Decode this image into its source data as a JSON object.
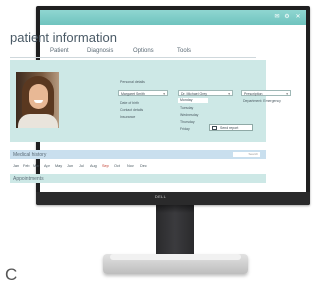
{
  "app": {
    "title": "patient information"
  },
  "tabs": [
    "Patient",
    "Diagnosis",
    "Options",
    "Tools"
  ],
  "window_icons": [
    "mail-icon",
    "gear-icon",
    "close-icon"
  ],
  "details": {
    "section_label": "Personal details",
    "name_field": "Margaret Smith",
    "field_labels": [
      "Date of birth",
      "Contact details",
      "Insurance"
    ],
    "doctor_field": "Dr. Michael Grey",
    "doctor_list": [
      "Monday",
      "Tuesday",
      "Wednesday",
      "Thursday",
      "Friday"
    ],
    "dept_field": "Prescription",
    "dept_label": "Department: Emergency",
    "request_button": "Send report"
  },
  "history": {
    "label": "Medical history",
    "search_placeholder": "Search"
  },
  "months": [
    "Jan",
    "Feb",
    "Mar",
    "Apr",
    "May",
    "Jun",
    "Jul",
    "Aug",
    "Sep",
    "Oct",
    "Nov",
    "Dec"
  ],
  "active_month": "Sep",
  "appointments": {
    "label": "Appointments"
  },
  "hardware": {
    "brand": "DELL",
    "figure_label": "C"
  },
  "colors": {
    "accent": "#7ccbc6",
    "panel": "#cde8e6",
    "history_bar": "#c9dfee",
    "alert": "#c0392b"
  }
}
